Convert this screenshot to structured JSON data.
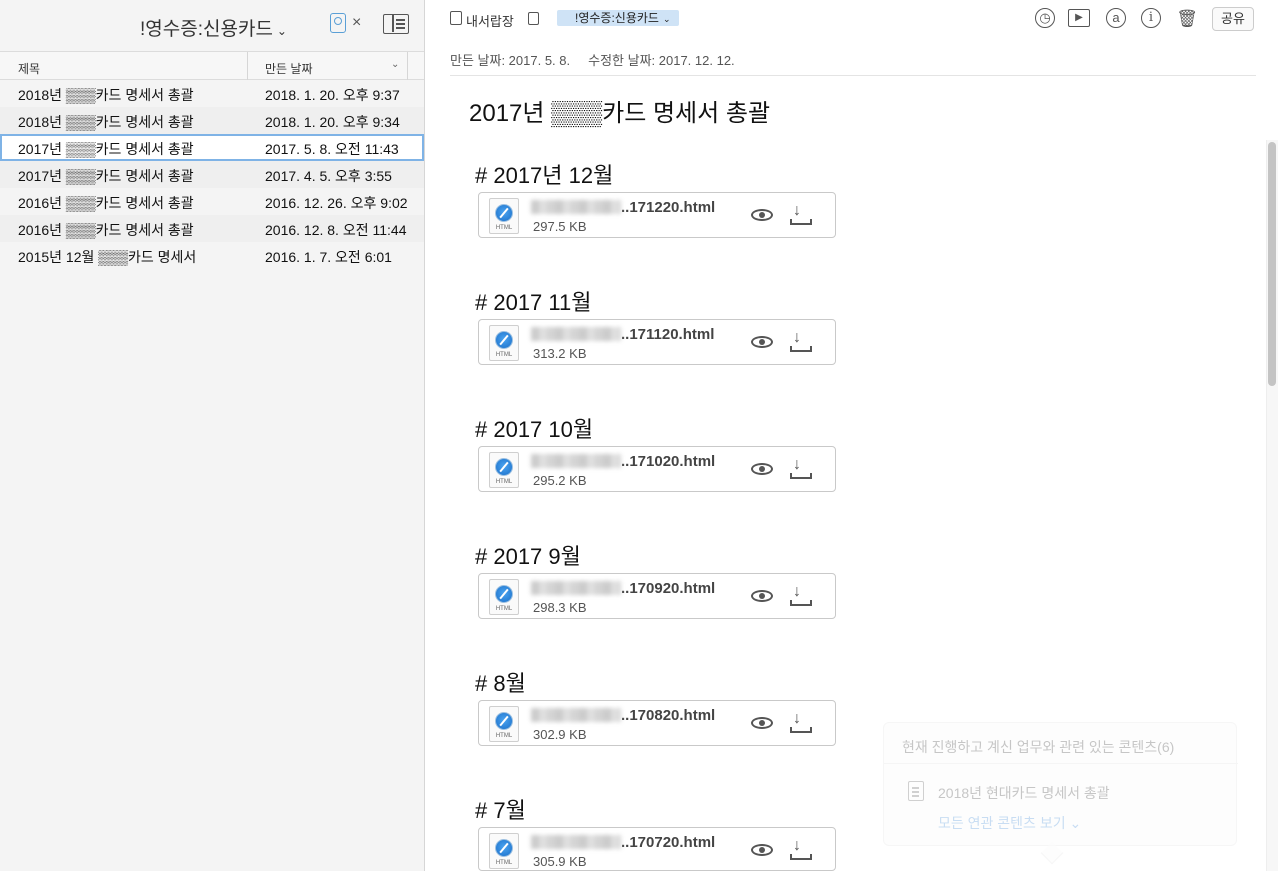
{
  "sidebar": {
    "notebook_title": "!영수증:신용카드",
    "chevron": "⌄",
    "close_glyph": "×",
    "columns": {
      "title": "제목",
      "date": "만든 날짜",
      "sort_glyph": "⌄"
    },
    "notes": [
      {
        "title": "2018년 ▒▒▒카드 명세서 총괄",
        "date": "2018. 1. 20. 오후 9:37"
      },
      {
        "title": "2018년 ▒▒▒카드 명세서 총괄",
        "date": "2018. 1. 20. 오후 9:34"
      },
      {
        "title": "2017년 ▒▒▒카드 명세서 총괄",
        "date": "2017. 5. 8. 오전 11:43"
      },
      {
        "title": "2017년 ▒▒▒카드 명세서 총괄",
        "date": "2017. 4. 5. 오후 3:55"
      },
      {
        "title": "2016년 ▒▒▒카드 명세서 총괄",
        "date": "2016. 12. 26. 오후 9:02"
      },
      {
        "title": "2016년 ▒▒▒카드 명세서 총괄",
        "date": "2016. 12. 8. 오전 11:44"
      },
      {
        "title": "2015년 12월 ▒▒▒카드 명세서",
        "date": "2016. 1. 7. 오전 6:01"
      }
    ],
    "selected_index": 2
  },
  "toolbar": {
    "scratchpad_label": "내서랍장",
    "notebook_pill": "!영수증:신용카드",
    "share_label": "공유",
    "icons": [
      "alarm-icon",
      "present-icon",
      "at-icon",
      "info-icon",
      "trash-icon"
    ]
  },
  "meta": {
    "created": "만든 날짜: 2017. 5. 8.",
    "modified": "수정한 날짜: 2017. 12. 12."
  },
  "note": {
    "title": "2017년 ▒▒▒카드 명세서 총괄",
    "sections": [
      {
        "heading": "# 2017년 12월",
        "file": "..171220.html",
        "size": "297.5 KB"
      },
      {
        "heading": "# 2017 11월",
        "file": "..171120.html",
        "size": "313.2 KB"
      },
      {
        "heading": "# 2017 10월",
        "file": "..171020.html",
        "size": "295.2 KB"
      },
      {
        "heading": "# 2017 9월",
        "file": "..170920.html",
        "size": "298.3 KB"
      },
      {
        "heading": "# 8월",
        "file": "..170820.html",
        "size": "302.9 KB"
      },
      {
        "heading": "# 7월",
        "file": "..170720.html",
        "size": "305.9 KB"
      }
    ],
    "file_ext_label": "HTML"
  },
  "popover": {
    "header": "현재 진행하고 계신 업무와 관련 있는 콘텐츠(6)",
    "item": "2018년 현대카드 명세서 총괄",
    "link": "모든 연관 콘텐츠 보기"
  }
}
